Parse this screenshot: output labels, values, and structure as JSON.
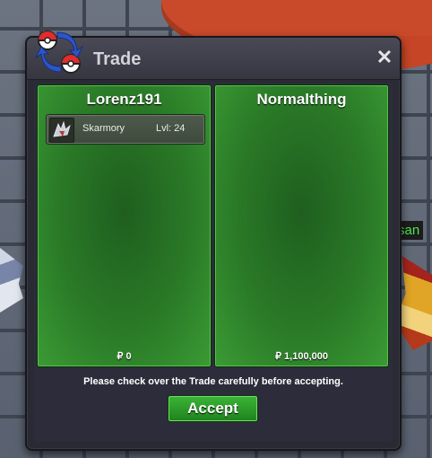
{
  "window": {
    "title": "Trade",
    "close_label": "✕"
  },
  "left_panel": {
    "player_name": "Lorenz191",
    "items": [
      {
        "name": "Skarmory",
        "level_label": "Lvl: 24"
      }
    ],
    "money": "₽ 0"
  },
  "right_panel": {
    "player_name": "Normalthing",
    "money": "₽ 1,100,000"
  },
  "notice": "Please check over the Trade carefully before accepting.",
  "accept_label": "Accept",
  "background": {
    "nametag": "san"
  },
  "colors": {
    "panel_green": "#2a7a27",
    "accept_green": "#2f9e2c",
    "window_bg": "#2a2a34",
    "roof_red": "#c94a2a"
  }
}
